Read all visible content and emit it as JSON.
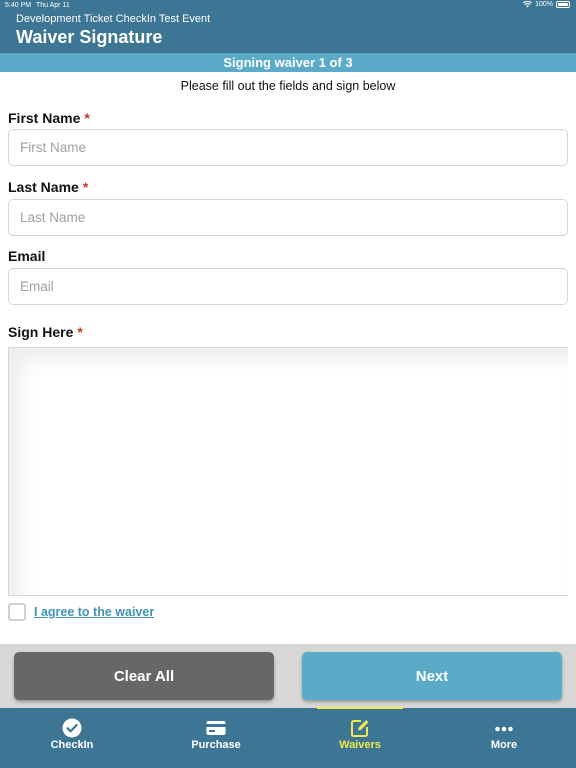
{
  "status_bar": {
    "time": "5:40 PM",
    "date": "Thu Apr 11",
    "battery": "100%"
  },
  "header": {
    "event_name": "Development Ticket CheckIn Test Event",
    "title": "Waiver Signature"
  },
  "progress": {
    "text": "Signing waiver 1 of 3"
  },
  "instructions": "Please fill out the fields and sign below",
  "form": {
    "first_name": {
      "label": "First Name",
      "required_mark": "*",
      "placeholder": "First Name",
      "value": ""
    },
    "last_name": {
      "label": "Last Name",
      "required_mark": "*",
      "placeholder": "Last Name",
      "value": ""
    },
    "email": {
      "label": "Email",
      "placeholder": "Email",
      "value": ""
    },
    "signature": {
      "label": "Sign Here",
      "required_mark": "*"
    },
    "agree": {
      "label": "I agree to the waiver",
      "checked": false
    }
  },
  "actions": {
    "clear_label": "Clear All",
    "next_label": "Next"
  },
  "tabs": [
    {
      "label": "CheckIn",
      "icon": "check-circle-icon",
      "active": false
    },
    {
      "label": "Purchase",
      "icon": "credit-card-icon",
      "active": false
    },
    {
      "label": "Waivers",
      "icon": "edit-icon",
      "active": true
    },
    {
      "label": "More",
      "icon": "more-dots-icon",
      "active": false
    }
  ],
  "colors": {
    "header": "#3d7694",
    "banner": "#5aaac8",
    "active_tab": "#f4e94a",
    "required": "#c0392b",
    "link": "#3f93b6"
  }
}
